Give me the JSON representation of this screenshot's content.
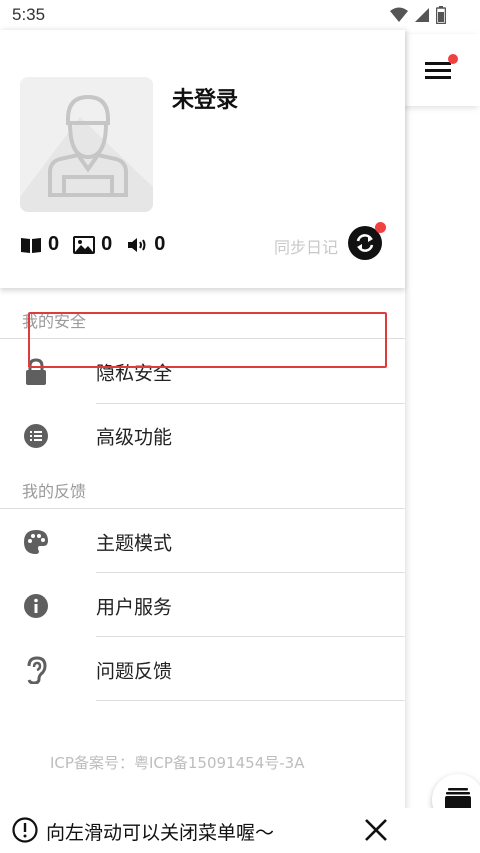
{
  "status": {
    "time": "5:35"
  },
  "profile": {
    "title": "未登录",
    "stats": [
      {
        "icon": "book-icon",
        "value": "0"
      },
      {
        "icon": "image-icon",
        "value": "0"
      },
      {
        "icon": "speaker-icon",
        "value": "0"
      }
    ],
    "sync_label": "同步日记"
  },
  "sections": {
    "security": "我的安全",
    "feedback": "我的反馈"
  },
  "menu": {
    "privacy": "隐私安全",
    "advanced": "高级功能",
    "theme": "主题模式",
    "service": "用户服务",
    "issue": "问题反馈"
  },
  "footer": {
    "icp": "ICP备案号：粤ICP备15091454号-3A",
    "hint": "向左滑动可以关闭菜单喔～"
  },
  "colors": {
    "highlight": "#e03b3b",
    "badge": "#f04040",
    "icon": "#5f5f5f"
  }
}
